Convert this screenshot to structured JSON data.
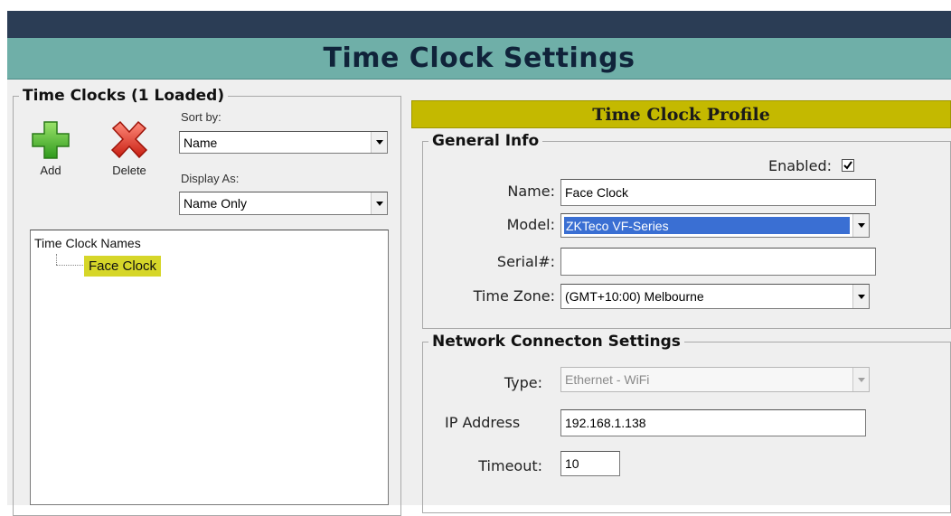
{
  "header": {
    "title": "Time Clock Settings"
  },
  "left_panel": {
    "group_title": "Time Clocks (1 Loaded)",
    "add_label": "Add",
    "delete_label": "Delete",
    "sort_by_label": "Sort by:",
    "sort_by_value": "Name",
    "display_as_label": "Display As:",
    "display_as_value": "Name Only",
    "tree": {
      "root": "Time Clock Names",
      "items": [
        "Face Clock"
      ]
    }
  },
  "profile": {
    "title": "Time Clock Profile",
    "general": {
      "group_title": "General Info",
      "enabled_label": "Enabled:",
      "enabled_checked": true,
      "name_label": "Name:",
      "name_value": "Face Clock",
      "model_label": "Model:",
      "model_value": "ZKTeco VF-Series",
      "serial_label": "Serial#:",
      "serial_value": "",
      "timezone_label": "Time Zone:",
      "timezone_value": "(GMT+10:00) Melbourne"
    },
    "network": {
      "group_title": "Network Connecton Settings",
      "type_label": "Type:",
      "type_value": "Ethernet - WiFi",
      "ip_label": "IP Address",
      "ip_value": "192.168.1.138",
      "timeout_label": "Timeout:",
      "timeout_value": "10"
    }
  },
  "colors": {
    "header_bg": "#6fafa8",
    "top_strip": "#2b3d55",
    "profile_bar": "#c4b900",
    "tree_highlight": "#d6d629",
    "selection": "#3a6fd3"
  }
}
